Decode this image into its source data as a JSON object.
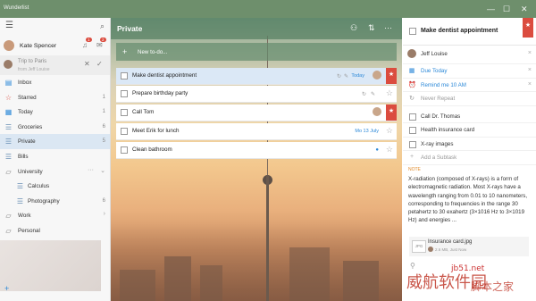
{
  "app": {
    "title": "Wunderlist"
  },
  "sidebar": {
    "user_name": "Kate Spencer",
    "bell_badge": "1",
    "chat_badge": "2",
    "notification": {
      "title": "Trip to Paris",
      "from": "from Jeff Louise"
    },
    "items": [
      {
        "label": "Inbox",
        "count": "",
        "icon": "inbox-icon"
      },
      {
        "label": "Starred",
        "count": "1",
        "icon": "star-icon"
      },
      {
        "label": "Today",
        "count": "1",
        "icon": "calendar-icon"
      },
      {
        "label": "Groceries",
        "count": "6",
        "icon": "list-icon"
      },
      {
        "label": "Private",
        "count": "5",
        "icon": "list-icon"
      },
      {
        "label": "Bills",
        "count": "",
        "icon": "list-icon"
      },
      {
        "label": "University",
        "count": "",
        "icon": "folder-icon"
      },
      {
        "label": "Calculus",
        "count": "",
        "icon": "list-icon"
      },
      {
        "label": "Photography",
        "count": "6",
        "icon": "list-icon"
      },
      {
        "label": "Work",
        "count": "",
        "icon": "folder-icon"
      },
      {
        "label": "Personal",
        "count": "",
        "icon": "folder-icon"
      }
    ]
  },
  "main": {
    "title": "Private",
    "add_placeholder": "New to-do...",
    "tasks": [
      {
        "text": "Make dentist appointment",
        "due": "Today"
      },
      {
        "text": "Prepare birthday party",
        "due": ""
      },
      {
        "text": "Call Tom",
        "due": ""
      },
      {
        "text": "Meet Erik for lunch",
        "due": "Mo 13 July"
      },
      {
        "text": "Clean bathroom",
        "due": ""
      }
    ]
  },
  "detail": {
    "title": "Make dentist appointment",
    "assignee": "Jeff Louise",
    "due": "Due Today",
    "reminder": "Remind me 10 AM",
    "repeat": "Never Repeat",
    "subtasks": [
      "Call Dr. Thomas",
      "Health insurance card",
      "X-ray images"
    ],
    "add_subtask": "Add a Subtask",
    "note_label": "NOTE",
    "note": "X-radiation (composed of X-rays) is a form of electromagnetic radiation. Most X-rays have a wavelength ranging from 0.01 to 10 nanometers, corresponding to frequencies in the range 30 petahertz to 30 exahertz (3×1016 Hz to 3×1019 Hz) and energies ...",
    "file_name": "Insurance card.jpg",
    "file_type": "JPG",
    "file_size": "2.6 MB, Just Now"
  },
  "watermark": {
    "site": "jb51.net",
    "cn1": "威航软件园",
    "cn2": "脚本之家"
  },
  "colors": {
    "accent": "#2b88d8",
    "flag": "#db4c3f",
    "header": "#6e8f6c"
  }
}
